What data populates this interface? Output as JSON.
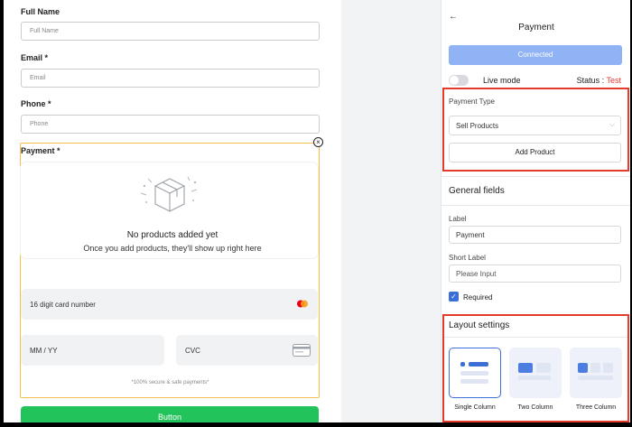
{
  "form": {
    "full_name": {
      "label": "Full Name",
      "placeholder": "Full Name"
    },
    "email": {
      "label": "Email *",
      "placeholder": "Email"
    },
    "phone": {
      "label": "Phone *",
      "placeholder": "Phone"
    },
    "payment": {
      "label": "Payment *",
      "empty_title": "No products added yet",
      "empty_subtitle": "Once you add products, they'll show up right here",
      "card_number": "16 digit card number",
      "expiry": "MM / YY",
      "cvc": "CVC",
      "secure_note": "*100% secure & safe payments*"
    },
    "button_label": "Button"
  },
  "panel": {
    "title": "Payment",
    "connected_label": "Connected",
    "live_mode_label": "Live mode",
    "status_label": "Status : ",
    "status_value": "Test",
    "payment_type_label": "Payment Type",
    "payment_type_value": "Sell Products",
    "add_product_label": "Add Product",
    "general_fields_title": "General fields",
    "label_caption": "Label",
    "label_value": "Payment",
    "short_label_caption": "Short Label",
    "short_label_placeholder": "Please Input",
    "required_label": "Required",
    "layout_title": "Layout settings",
    "layouts": [
      "Single Column",
      "Two Column",
      "Three Column"
    ]
  },
  "colors": {
    "accent": "#3b6fd6",
    "connected": "#8fb3f4",
    "highlight_border": "#e53b2d",
    "selected_field_border": "#f2c04a",
    "primary_button": "#22c35a",
    "status_test": "#e53935"
  },
  "icons": [
    "empty-box-icon",
    "close-icon",
    "mastercard-icon",
    "card-icon",
    "back-arrow-icon",
    "chevron-down-icon",
    "check-icon"
  ]
}
